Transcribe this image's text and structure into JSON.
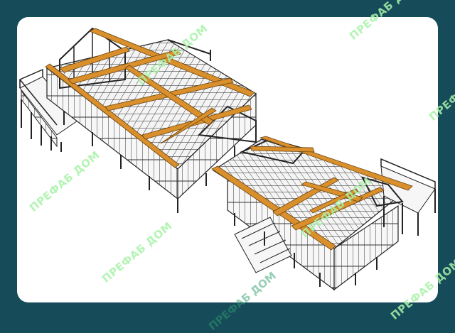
{
  "watermark": {
    "text": "ПРЕФАБ ДОМ"
  },
  "colors": {
    "background": "#164b5a",
    "card": "#ffffff",
    "beam": "#d98f2b",
    "beam_edge": "#6b4513",
    "steel": "#e8e8e8",
    "steel_edge": "#2a2a2a",
    "watermark": "#a8f3a8"
  }
}
